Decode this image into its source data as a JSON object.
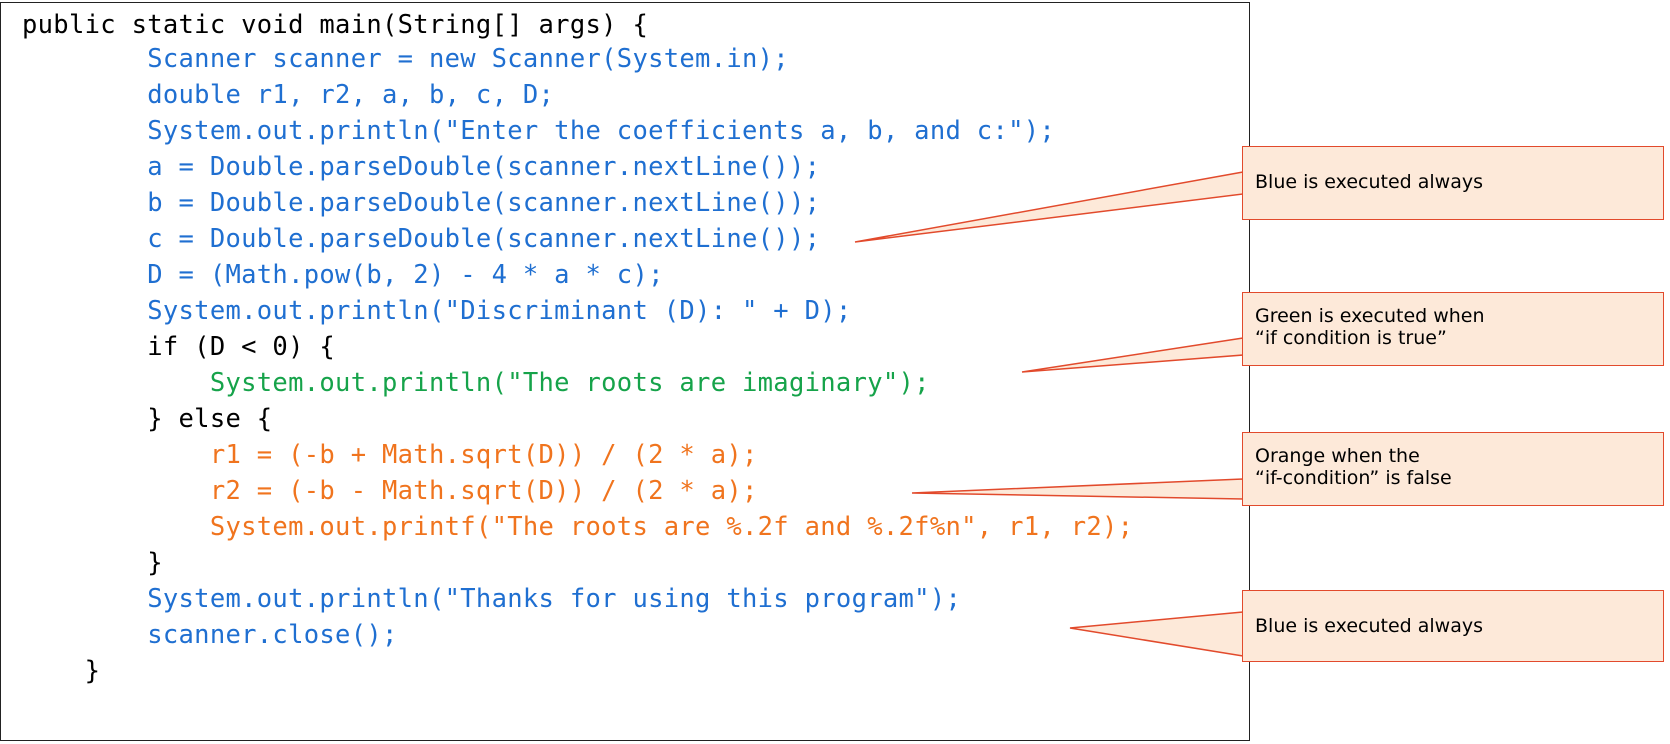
{
  "code": [
    {
      "text": "public static void main(String[] args) {",
      "color": "black"
    },
    {
      "text": "        Scanner scanner = new Scanner(System.in);",
      "color": "blue"
    },
    {
      "text": "        double r1, r2, a, b, c, D;",
      "color": "blue"
    },
    {
      "text": "        System.out.println(\"Enter the coefficients a, b, and c:\");",
      "color": "blue"
    },
    {
      "text": "        a = Double.parseDouble(scanner.nextLine());",
      "color": "blue"
    },
    {
      "text": "        b = Double.parseDouble(scanner.nextLine());",
      "color": "blue"
    },
    {
      "text": "        c = Double.parseDouble(scanner.nextLine());",
      "color": "blue"
    },
    {
      "text": "        D = (Math.pow(b, 2) - 4 * a * c);",
      "color": "blue"
    },
    {
      "text": "        System.out.println(\"Discriminant (D): \" + D);",
      "color": "blue"
    },
    {
      "text": "        if (D < 0) {",
      "color": "black"
    },
    {
      "text": "            System.out.println(\"The roots are imaginary\");",
      "color": "green"
    },
    {
      "text": "        } else {",
      "color": "black"
    },
    {
      "text": "            r1 = (-b + Math.sqrt(D)) / (2 * a);",
      "color": "orange"
    },
    {
      "text": "            r2 = (-b - Math.sqrt(D)) / (2 * a);",
      "color": "orange"
    },
    {
      "text": "            System.out.printf(\"The roots are %.2f and %.2f%n\", r1, r2);",
      "color": "orange"
    },
    {
      "text": "        }",
      "color": "black"
    },
    {
      "text": "        System.out.println(\"Thanks for using this program\");",
      "color": "blue"
    },
    {
      "text": "        scanner.close();",
      "color": "blue"
    },
    {
      "text": "    }",
      "color": "black"
    }
  ],
  "colors": {
    "black": "#000000",
    "blue": "#1f6fd1",
    "green": "#16a34a",
    "orange": "#f0741e",
    "callout_fill": "#fde9d9",
    "callout_border": "#e24a2c"
  },
  "callouts": [
    {
      "lines": [
        "Blue is executed always"
      ]
    },
    {
      "lines": [
        "Green is executed when",
        "“if condition is true”"
      ]
    },
    {
      "lines": [
        "Orange when the",
        "“if-condition” is false"
      ]
    },
    {
      "lines": [
        "Blue is executed always"
      ]
    }
  ]
}
